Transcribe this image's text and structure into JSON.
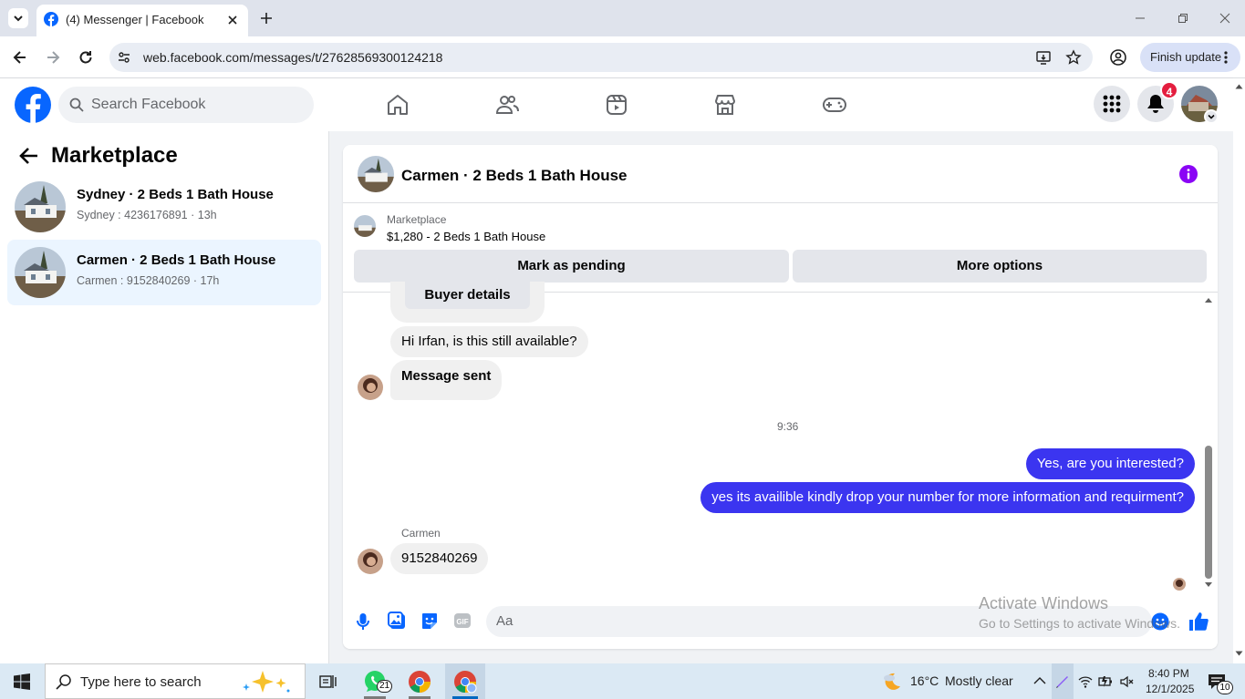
{
  "browser": {
    "tab_title": "(4) Messenger | Facebook",
    "url": "web.facebook.com/messages/t/27628569300124218",
    "finish_update": "Finish update"
  },
  "header": {
    "search_placeholder": "Search Facebook",
    "notification_count": "4"
  },
  "sidebar": {
    "title": "Marketplace",
    "conversations": [
      {
        "title": "Sydney · 2 Beds 1 Bath House",
        "subtitle": "Sydney : 4236176891 · 13h"
      },
      {
        "title": "Carmen · 2 Beds 1 Bath House",
        "subtitle": "Carmen : 9152840269 · 17h"
      }
    ]
  },
  "chat": {
    "title": "Carmen · 2 Beds 1 Bath House",
    "listing_source": "Marketplace",
    "listing_detail": "$1,280 - 2 Beds 1 Bath House",
    "mark_pending": "Mark as pending",
    "more_options": "More options",
    "buyer_details": "Buyer details",
    "messages": {
      "m1": "Hi Irfan, is this still available?",
      "m2": "Message sent",
      "time": "9:36",
      "m3": "Yes, are you interested?",
      "m4": "yes its availible kindly drop your number for more information and requirment?",
      "sender": "Carmen",
      "m5": "9152840269"
    },
    "composer_placeholder": "Aa",
    "watermark_line1": "Activate Windows",
    "watermark_line2": "Go to Settings to activate Windows."
  },
  "taskbar": {
    "search_placeholder": "Type here to search",
    "whatsapp_badge": "21",
    "weather_temp": "16°C",
    "weather_desc": "Mostly clear",
    "time": "8:40 PM",
    "date": "12/1/2025",
    "notif_count": "10"
  },
  "colors": {
    "fb_blue": "#0866ff",
    "outgoing_bubble": "#3b35f0",
    "notification_red": "#e41e3f",
    "info_purple": "#8a05f5"
  }
}
